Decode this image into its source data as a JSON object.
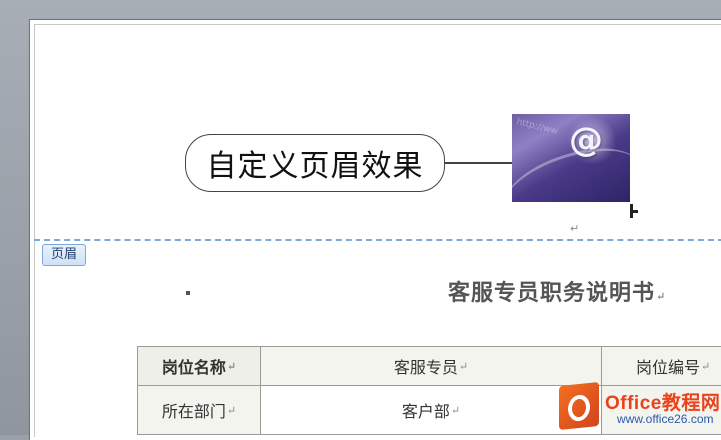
{
  "header_callout": {
    "text": "自定义页眉效果"
  },
  "header_image": {
    "icon": "at-sign-email-icon",
    "symbol": "@",
    "faint_text": "http://ww"
  },
  "header_tag": {
    "label": "页眉"
  },
  "document": {
    "title": "客服专员职务说明书",
    "para_mark": "↵"
  },
  "table": {
    "rows": [
      {
        "c1": "岗位名称",
        "c2": "客服专员",
        "c3": "岗位编号"
      },
      {
        "c1": "所在部门",
        "c2": "客户部",
        "c3": ""
      }
    ]
  },
  "watermark": {
    "name": "Office教程网",
    "url": "www.office26.com",
    "colors": {
      "orange": "#e9431c",
      "blue": "#2b5aa8"
    }
  }
}
